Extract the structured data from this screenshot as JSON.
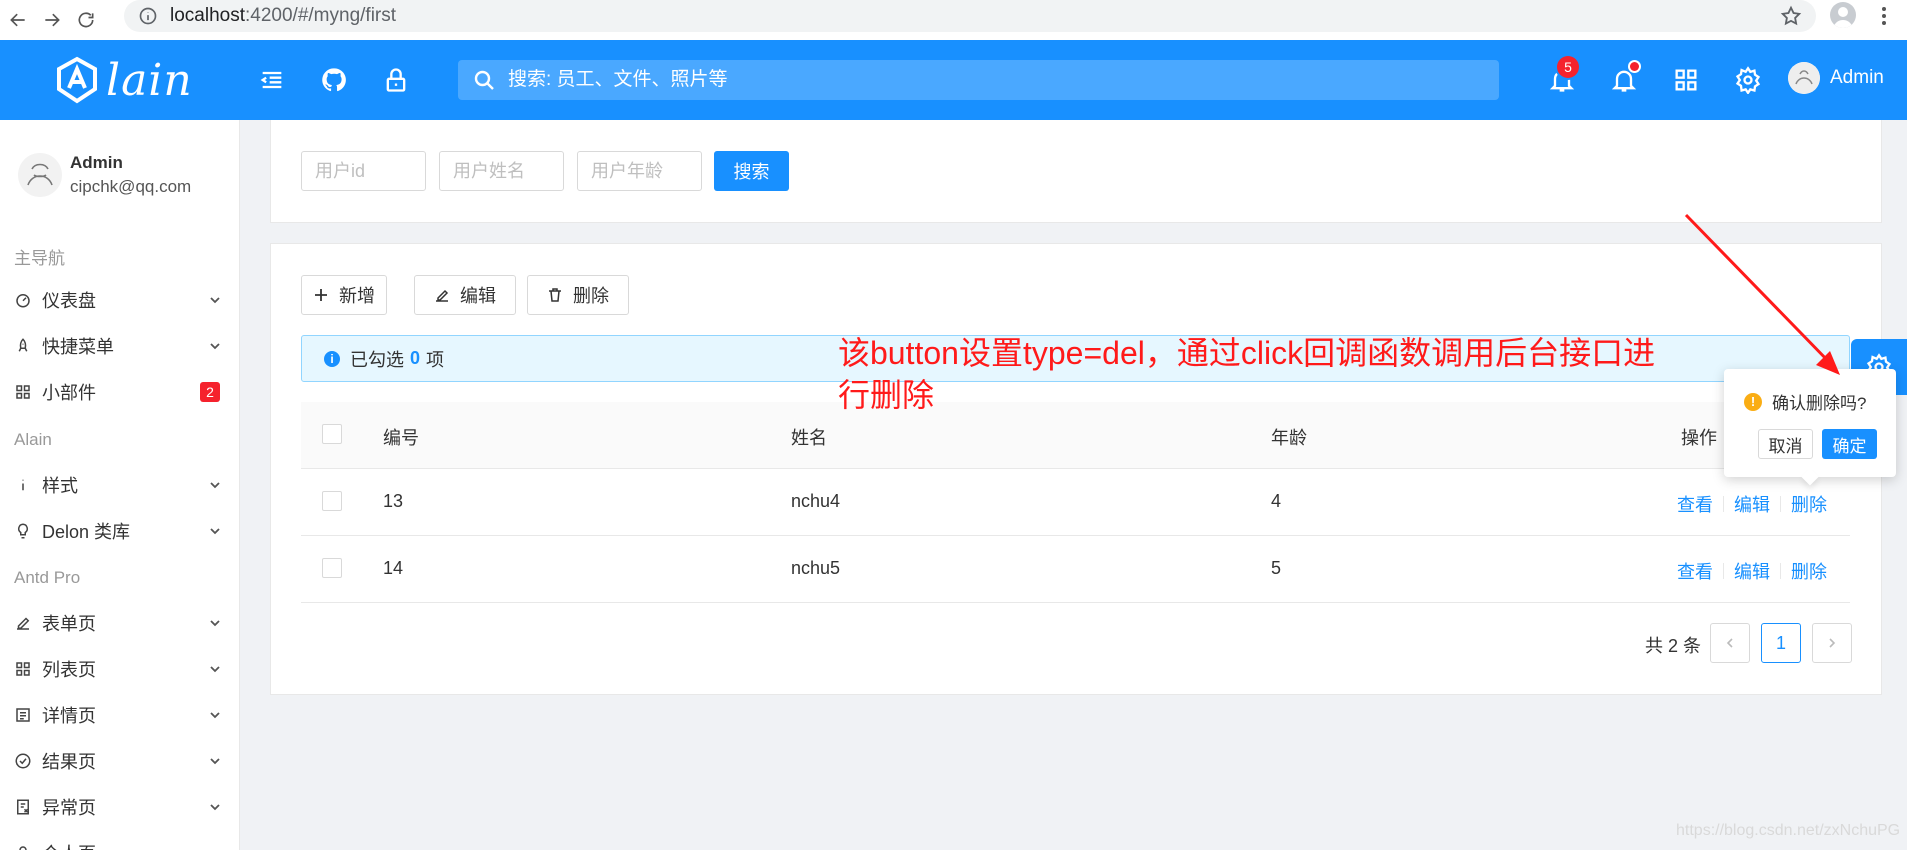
{
  "browser": {
    "url_host": "localhost",
    "url_rest": ":4200/#/myng/first"
  },
  "header": {
    "logo_text": "lain",
    "search_placeholder": "搜索: 员工、文件、照片等",
    "notice_count": "5",
    "user_name": "Admin",
    "accent": "#1890ff"
  },
  "sidebar": {
    "user_name": "Admin",
    "user_email": "cipchk@qq.com",
    "groups": [
      "主导航",
      "Alain",
      "Antd Pro"
    ],
    "items": [
      {
        "label": "仪表盘",
        "icon": "dashboard-icon"
      },
      {
        "label": "快捷菜单",
        "icon": "rocket-icon"
      },
      {
        "label": "小部件",
        "icon": "appstore-icon",
        "badge": "2"
      },
      {
        "label": "样式",
        "icon": "info-icon"
      },
      {
        "label": "Delon 类库",
        "icon": "bulb-icon"
      },
      {
        "label": "表单页",
        "icon": "edit-icon"
      },
      {
        "label": "列表页",
        "icon": "appstore-icon"
      },
      {
        "label": "详情页",
        "icon": "profile-icon"
      },
      {
        "label": "结果页",
        "icon": "check-circle-icon"
      },
      {
        "label": "异常页",
        "icon": "exception-icon"
      },
      {
        "label": "个人页",
        "icon": "user-icon"
      }
    ]
  },
  "filter": {
    "id_placeholder": "用户id",
    "name_placeholder": "用户姓名",
    "age_placeholder": "用户年龄",
    "search_label": "搜索"
  },
  "toolbar": {
    "add_label": "新增",
    "edit_label": "编辑",
    "delete_label": "删除"
  },
  "alert": {
    "prefix": "已勾选",
    "count": "0",
    "suffix": "项"
  },
  "table": {
    "columns": [
      "编号",
      "姓名",
      "年龄",
      "操作"
    ],
    "rows": [
      {
        "id": "13",
        "name": "nchu4",
        "age": "4",
        "ops": [
          "查看",
          "编辑",
          "删除"
        ]
      },
      {
        "id": "14",
        "name": "nchu5",
        "age": "5",
        "ops": [
          "查看",
          "编辑",
          "删除"
        ]
      }
    ]
  },
  "pagination": {
    "total_text": "共 2 条",
    "current_page": "1"
  },
  "popconfirm": {
    "message": "确认删除吗?",
    "cancel_label": "取消",
    "ok_label": "确定"
  },
  "annotation": {
    "line1": "该button设置type=del，通过click回调函数调用后台接口进",
    "line2": "行删除",
    "color": "#ff1a1a"
  },
  "watermark": "https://blog.csdn.net/zxNchuPG"
}
